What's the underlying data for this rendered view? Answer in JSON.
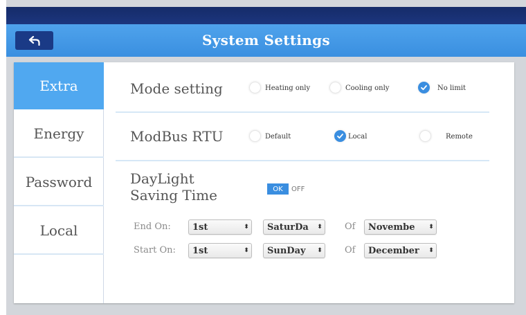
{
  "header": {
    "title": "System Settings",
    "back_icon": "back-arrow-icon"
  },
  "sidebar": {
    "items": [
      {
        "label": "Extra",
        "active": true
      },
      {
        "label": "Energy",
        "active": false
      },
      {
        "label": "Password",
        "active": false
      },
      {
        "label": "Local",
        "active": false
      }
    ]
  },
  "mode_setting": {
    "label": "Mode setting",
    "options": [
      {
        "label": "Heating only",
        "checked": false
      },
      {
        "label": "Cooling only",
        "checked": false
      },
      {
        "label": "No limit",
        "checked": true
      }
    ]
  },
  "modbus": {
    "label": "ModBus RTU",
    "options": [
      {
        "label": "Default",
        "checked": false
      },
      {
        "label": "Local",
        "checked": true
      },
      {
        "label": "Remote",
        "checked": false
      }
    ]
  },
  "daylight": {
    "label_line1": "DayLight",
    "label_line2": "Saving Time",
    "toggle_on": "OK",
    "toggle_off": "OFF",
    "enabled": true,
    "end": {
      "label": "End  On:",
      "week": "1st",
      "day": "SaturDa",
      "of_label": "Of",
      "month": "Novembe"
    },
    "start": {
      "label": "Start On:",
      "week": "1st",
      "day": "SunDay",
      "of_label": "Of",
      "month": "December"
    }
  },
  "colors": {
    "accent": "#3a8ee0",
    "topbar": "#152b69",
    "titlebar": "#4fa3ec",
    "active_tab": "#50a8f0"
  }
}
